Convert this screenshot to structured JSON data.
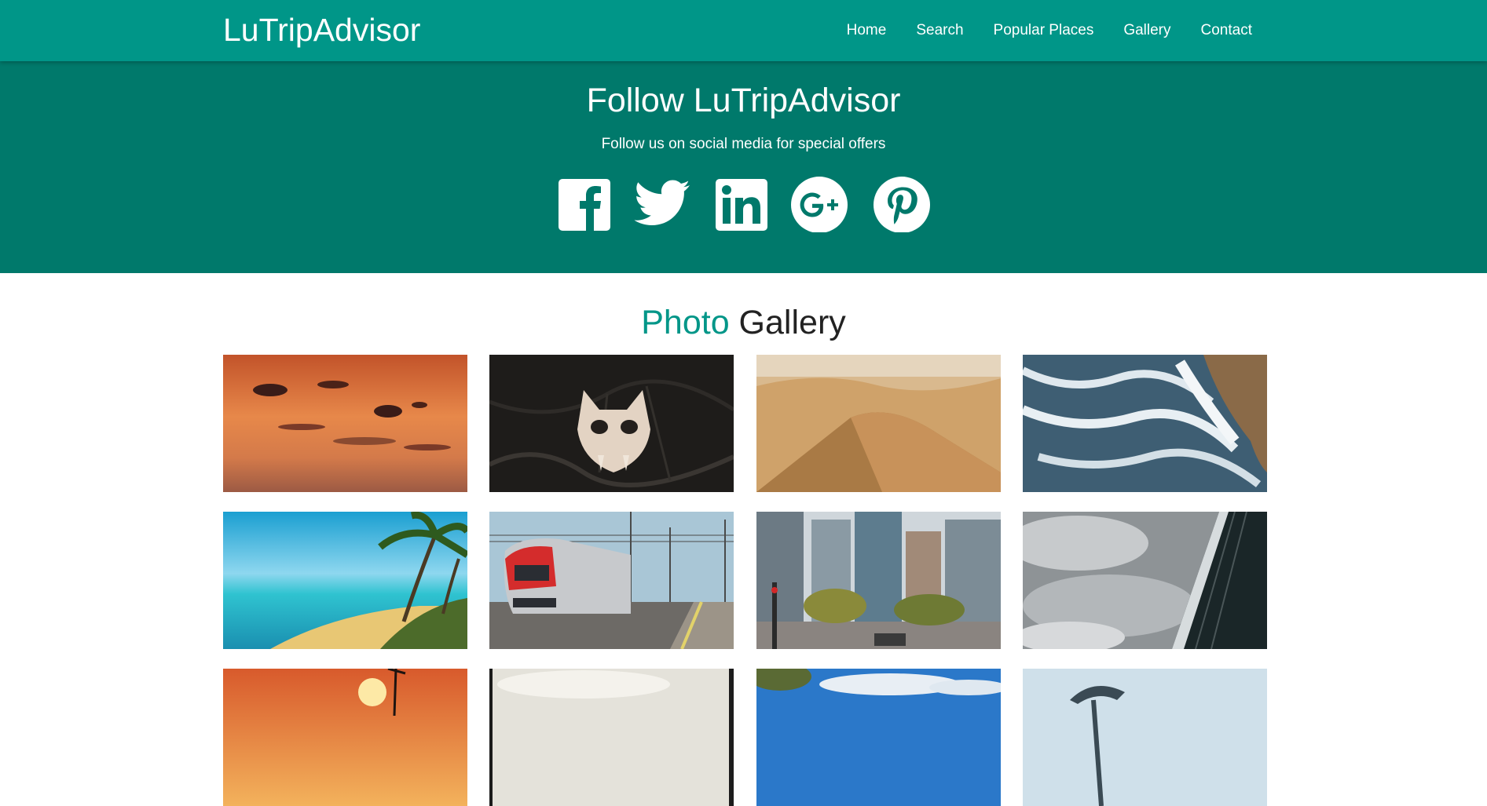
{
  "navbar": {
    "brand": "LuTripAdvisor",
    "links": [
      "Home",
      "Search",
      "Popular Places",
      "Gallery",
      "Contact"
    ]
  },
  "social": {
    "title": "Follow LuTripAdvisor",
    "subtitle": "Follow us on social media for special offers",
    "icons": [
      "facebook-icon",
      "twitter-icon",
      "linkedin-icon",
      "google-plus-icon",
      "pinterest-icon"
    ]
  },
  "gallery": {
    "title_accent": "Photo",
    "title_rest": " Gallery",
    "photos": [
      "sunset-clouds",
      "skull-mask",
      "desert-dunes",
      "ocean-waves",
      "tropical-beach",
      "red-train",
      "city-street",
      "clouds-building",
      "palm-sunset",
      "cloudy-sky",
      "blue-sky-tree",
      "modern-tower"
    ]
  },
  "colors": {
    "navbar": "#009688",
    "banner": "#00796b",
    "accent": "#009688",
    "text": "#222222"
  }
}
